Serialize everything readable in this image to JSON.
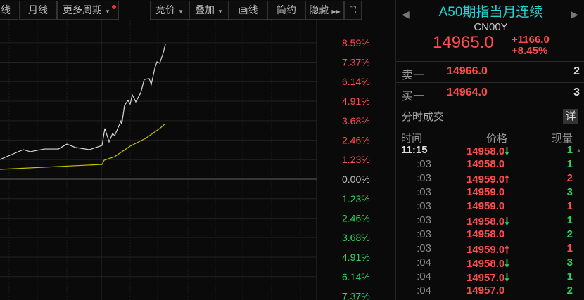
{
  "toolbar": {
    "left": [
      {
        "label": "线"
      },
      {
        "label": "月线"
      },
      {
        "label": "更多周期"
      }
    ],
    "right": [
      {
        "label": "竞价"
      },
      {
        "label": "叠加"
      },
      {
        "label": "画线"
      },
      {
        "label": "简约"
      },
      {
        "label": "隐藏"
      }
    ]
  },
  "quote": {
    "title": "A50期指当月连续",
    "code": "CN00Y",
    "price": "14965.0",
    "change": "+1166.0",
    "change_pct": "+8.45%"
  },
  "orderbook": [
    {
      "label": "卖一",
      "price": "14966.0",
      "vol": "2"
    },
    {
      "label": "买一",
      "price": "14964.0",
      "vol": "3"
    }
  ],
  "ticks": {
    "section": "分时成交",
    "detail": "详",
    "headers": {
      "time": "时间",
      "price": "价格",
      "vol": "现量"
    },
    "rows": [
      {
        "time": "11:15",
        "price": "14958.0",
        "dir": "down",
        "vol": "1",
        "vdir": "dn"
      },
      {
        "time": ":03",
        "price": "14958.0",
        "dir": "",
        "vol": "1",
        "vdir": "dn"
      },
      {
        "time": ":03",
        "price": "14959.0",
        "dir": "up",
        "vol": "2",
        "vdir": "up"
      },
      {
        "time": ":03",
        "price": "14959.0",
        "dir": "",
        "vol": "3",
        "vdir": "dn"
      },
      {
        "time": ":03",
        "price": "14959.0",
        "dir": "",
        "vol": "1",
        "vdir": "up"
      },
      {
        "time": ":03",
        "price": "14958.0",
        "dir": "down",
        "vol": "1",
        "vdir": "dn"
      },
      {
        "time": ":03",
        "price": "14958.0",
        "dir": "",
        "vol": "2",
        "vdir": "dn"
      },
      {
        "time": ":03",
        "price": "14959.0",
        "dir": "up",
        "vol": "1",
        "vdir": "up"
      },
      {
        "time": ":04",
        "price": "14958.0",
        "dir": "down",
        "vol": "3",
        "vdir": "dn"
      },
      {
        "time": ":04",
        "price": "14957.0",
        "dir": "down",
        "vol": "1",
        "vdir": "dn"
      },
      {
        "time": ":04",
        "price": "14957.0",
        "dir": "",
        "vol": "2",
        "vdir": "dn"
      }
    ]
  },
  "colors": {
    "up": "#ff4d4d",
    "down": "#2fd35a",
    "price_line": "#d8d8d8",
    "avg_line": "#c8c000",
    "title": "#22d3d3"
  },
  "chart_data": {
    "type": "line",
    "ylim": [
      -7.9,
      8.9
    ],
    "xlim": [
      0,
      450
    ],
    "y_ticks": [
      {
        "value": 8.59,
        "label": "8.59%"
      },
      {
        "value": 7.37,
        "label": "7.37%"
      },
      {
        "value": 6.14,
        "label": "6.14%"
      },
      {
        "value": 4.91,
        "label": "4.91%"
      },
      {
        "value": 3.68,
        "label": "3.68%"
      },
      {
        "value": 2.46,
        "label": "2.46%"
      },
      {
        "value": 1.23,
        "label": "1.23%"
      },
      {
        "value": 0,
        "label": "0.00%"
      },
      {
        "value": -1.23,
        "label": "1.23%"
      },
      {
        "value": -2.46,
        "label": "2.46%"
      },
      {
        "value": -3.68,
        "label": "3.68%"
      },
      {
        "value": -4.91,
        "label": "4.91%"
      },
      {
        "value": -6.14,
        "label": "6.14%"
      },
      {
        "value": -7.37,
        "label": "7.37%"
      }
    ],
    "series": [
      {
        "name": "price",
        "x": [
          0,
          33,
          43,
          63,
          83,
          95,
          107,
          127,
          145,
          149,
          155,
          160,
          163,
          172,
          173,
          177,
          182,
          185,
          188,
          193,
          200,
          205,
          212,
          215,
          220,
          223,
          227,
          232,
          235
        ],
        "y": [
          1.24,
          1.86,
          1.73,
          1.9,
          1.9,
          2.21,
          2.0,
          1.86,
          2.12,
          3.19,
          2.35,
          2.88,
          2.74,
          3.67,
          3.45,
          4.65,
          4.96,
          4.73,
          5.31,
          4.87,
          5.44,
          6.28,
          6.33,
          5.97,
          6.99,
          7.39,
          7.3,
          7.96,
          8.5
        ]
      },
      {
        "name": "average",
        "x": [
          0,
          145,
          148,
          163,
          185,
          207,
          227,
          235
        ],
        "y": [
          0.62,
          0.93,
          1.19,
          1.42,
          2.08,
          2.57,
          3.19,
          3.5
        ]
      }
    ]
  }
}
